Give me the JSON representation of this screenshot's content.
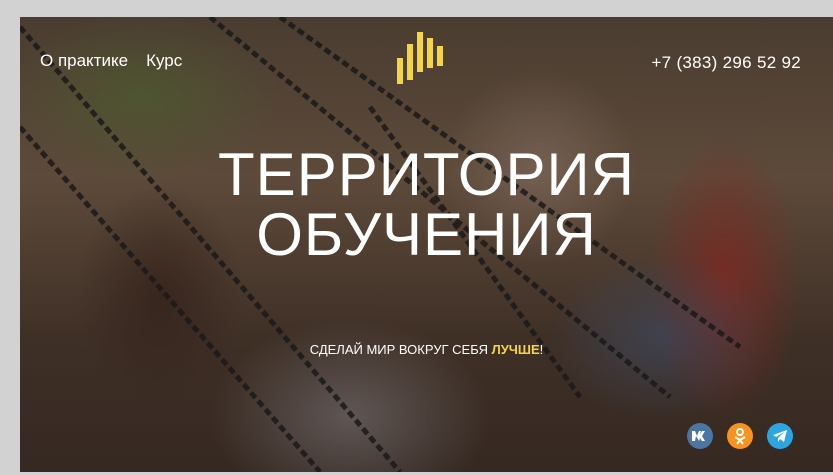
{
  "nav": {
    "items": [
      "О практике",
      "Курс"
    ]
  },
  "header": {
    "phone": "+7 (383) 296 52 92"
  },
  "hero": {
    "title_line1": "ТЕРРИТОРИЯ",
    "title_line2": "ОБУЧЕНИЯ",
    "tagline_prefix": "СДЕЛАЙ МИР ВОКРУГ СЕБЯ ",
    "tagline_highlight": "ЛУЧШЕ",
    "tagline_suffix": "!"
  },
  "social": [
    {
      "name": "vk-icon",
      "label": "vk",
      "color": "#4c75a3"
    },
    {
      "name": "odnoklassniki-icon",
      "label": "ok",
      "color": "#f7931e"
    },
    {
      "name": "telegram-icon",
      "label": "tg",
      "color": "#2ca5e0"
    }
  ],
  "colors": {
    "accent": "#f5d447",
    "text": "#ffffff"
  }
}
